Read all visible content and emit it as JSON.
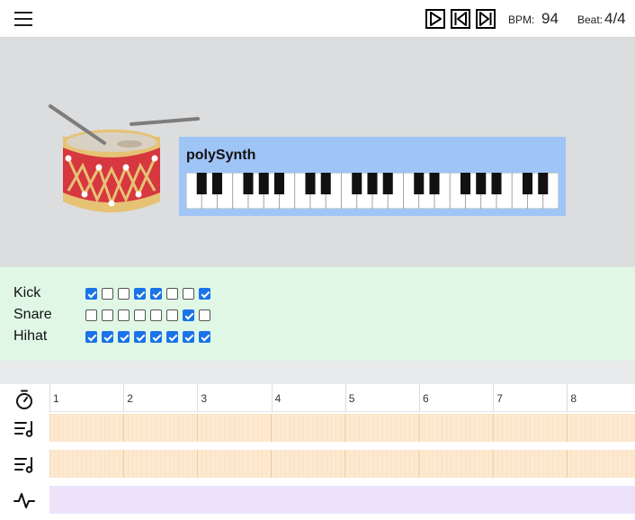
{
  "toolbar": {
    "bpm_label": "BPM:",
    "bpm_value": "94",
    "beat_label": "Beat:",
    "beat_value": "4/4",
    "icons": [
      "menu-icon",
      "play-icon",
      "skip-back-icon",
      "skip-forward-icon"
    ]
  },
  "synth": {
    "title": "polySynth",
    "color": "#9fc4f6"
  },
  "sequencer": {
    "rows": [
      {
        "label": "Kick",
        "steps": [
          true,
          false,
          false,
          true,
          true,
          false,
          false,
          true
        ]
      },
      {
        "label": "Snare",
        "steps": [
          false,
          false,
          false,
          false,
          false,
          false,
          true,
          false
        ]
      },
      {
        "label": "Hihat",
        "steps": [
          true,
          true,
          true,
          true,
          true,
          true,
          true,
          true
        ]
      }
    ]
  },
  "timeline": {
    "bars": [
      "1",
      "2",
      "3",
      "4",
      "5",
      "6",
      "7",
      "8"
    ],
    "tracks": [
      {
        "icon": "playlist-music-icon",
        "color": "#fde9cf"
      },
      {
        "icon": "playlist-music-icon",
        "color": "#fde9cf"
      },
      {
        "icon": "activity-icon",
        "color": "#ece3fb"
      }
    ],
    "ruler_icon": "timer-icon"
  }
}
